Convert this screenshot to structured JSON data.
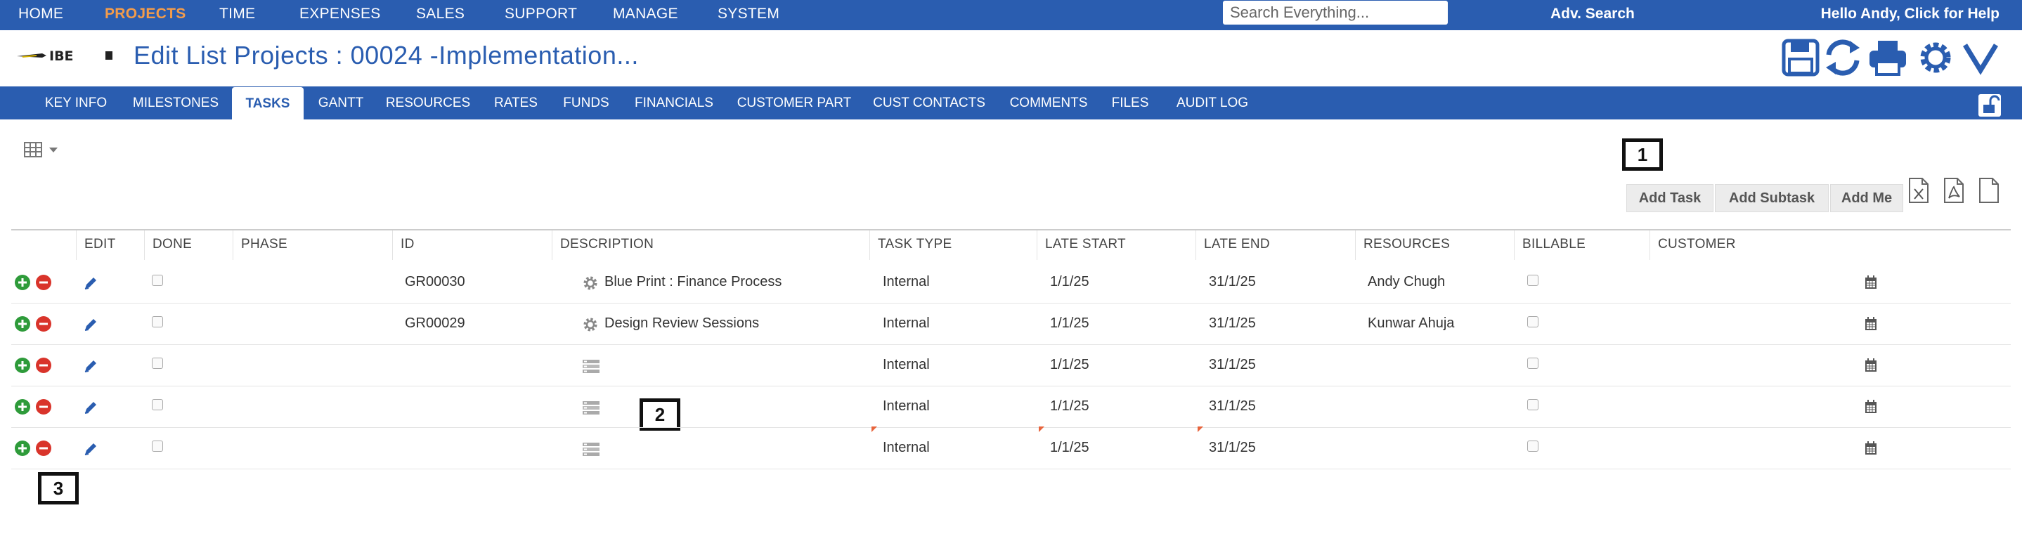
{
  "topnav": {
    "items": [
      "HOME",
      "PROJECTS",
      "TIME",
      "EXPENSES",
      "SALES",
      "SUPPORT",
      "MANAGE",
      "SYSTEM"
    ],
    "active": "PROJECTS",
    "search_placeholder": "Search Everything...",
    "adv_search": "Adv. Search",
    "user_greeting": "Hello Andy, Click for Help"
  },
  "header": {
    "logo_text": "IBE",
    "title": "Edit List Projects : 00024 -Implementation...",
    "icons": [
      "save-icon",
      "refresh-icon",
      "print-icon",
      "gear-icon",
      "chevron-down-icon"
    ]
  },
  "tabs": [
    "KEY INFO",
    "MILESTONES",
    "TASKS",
    "GANTT",
    "RESOURCES",
    "RATES",
    "FUNDS",
    "FINANCIALS",
    "CUSTOMER PART",
    "CUST CONTACTS",
    "COMMENTS",
    "FILES",
    "AUDIT LOG"
  ],
  "active_tab": "TASKS",
  "actions": {
    "add_task": "Add Task",
    "add_subtask": "Add Subtask",
    "add_me": "Add Me",
    "export_icons": [
      "excel-export-icon",
      "pdf-export-icon",
      "document-export-icon"
    ]
  },
  "annotations": [
    "1",
    "2",
    "3"
  ],
  "table": {
    "columns": [
      "EDIT",
      "DONE",
      "PHASE",
      "ID",
      "DESCRIPTION",
      "TASK TYPE",
      "LATE START",
      "LATE END",
      "RESOURCES",
      "BILLABLE",
      "CUSTOMER"
    ],
    "rows": [
      {
        "id": "GR00030",
        "description": "Blue Print : Finance Process",
        "desc_icon": "gear-icon",
        "task_type": "Internal",
        "late_start": "1/1/25",
        "late_end": "31/1/25",
        "resources": "Andy Chugh"
      },
      {
        "id": "GR00029",
        "description": "Design Review Sessions",
        "desc_icon": "gear-icon",
        "task_type": "Internal",
        "late_start": "1/1/25",
        "late_end": "31/1/25",
        "resources": "Kunwar Ahuja"
      },
      {
        "id": "",
        "description": "",
        "desc_icon": "list-icon",
        "task_type": "Internal",
        "late_start": "1/1/25",
        "late_end": "31/1/25",
        "resources": ""
      },
      {
        "id": "",
        "description": "",
        "desc_icon": "list-icon",
        "task_type": "Internal",
        "late_start": "1/1/25",
        "late_end": "31/1/25",
        "resources": ""
      },
      {
        "id": "",
        "description": "",
        "desc_icon": "list-icon",
        "task_type": "Internal",
        "late_start": "1/1/25",
        "late_end": "31/1/25",
        "resources": ""
      }
    ]
  },
  "colors": {
    "brand": "#2a5db0",
    "active_nav": "#f39c4b",
    "add": "#2e9b3a",
    "remove": "#d9342b"
  }
}
